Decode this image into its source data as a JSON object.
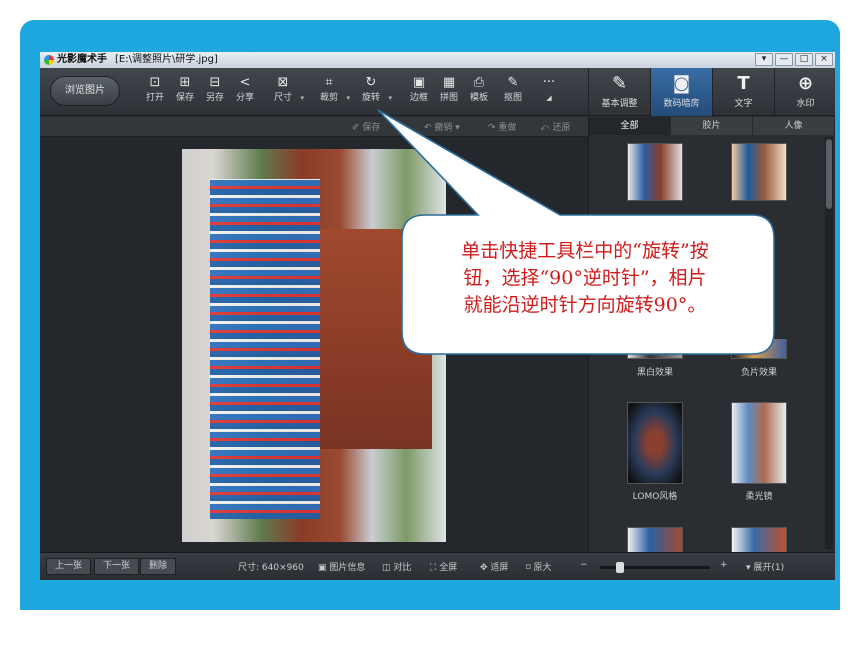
{
  "window": {
    "app_name": "光影魔术手",
    "file_path": "[E:\\调整照片\\研学.jpg]",
    "buttons": [
      "▾",
      "—",
      "□",
      "×"
    ]
  },
  "toolbar": {
    "browse_label": "浏览图片",
    "tools": [
      {
        "label": "打开",
        "icon": "open-icon",
        "glyph": "⊡"
      },
      {
        "label": "保存",
        "icon": "save-icon",
        "glyph": "⊞"
      },
      {
        "label": "另存",
        "icon": "save-as-icon",
        "glyph": "⊟"
      },
      {
        "label": "分享",
        "icon": "share-icon",
        "glyph": "<"
      },
      {
        "label": "尺寸",
        "icon": "resize-icon",
        "glyph": "⊠"
      },
      {
        "label": "裁剪",
        "icon": "crop-icon",
        "glyph": "⌗"
      },
      {
        "label": "旋转",
        "icon": "rotate-icon",
        "glyph": "↻"
      },
      {
        "label": "边框",
        "icon": "border-icon",
        "glyph": "▣"
      },
      {
        "label": "拼图",
        "icon": "collage-icon",
        "glyph": "▦"
      },
      {
        "label": "模板",
        "icon": "template-icon",
        "glyph": "⎙"
      },
      {
        "label": "抠图",
        "icon": "cutout-icon",
        "glyph": "✎"
      },
      {
        "label": "···",
        "icon": "more-icon",
        "glyph": "◢"
      }
    ],
    "modes": [
      {
        "label": "基本调整",
        "icon": "basic-adjust-icon",
        "glyph": "✎"
      },
      {
        "label": "数码暗房",
        "icon": "darkroom-icon",
        "glyph": "◙"
      },
      {
        "label": "文字",
        "icon": "text-icon",
        "glyph": "T"
      },
      {
        "label": "水印",
        "icon": "watermark-icon",
        "glyph": "⊕"
      }
    ]
  },
  "subbar": {
    "save_label": "保存",
    "undo_label": "撤销",
    "redo_label": "重做",
    "restore_label": "还原"
  },
  "side_panel": {
    "tabs": [
      "全部",
      "胶片",
      "人像"
    ],
    "effects": [
      "黑白效果",
      "负片效果",
      "LOMO风格",
      "柔光镜"
    ]
  },
  "status": {
    "prev": "上一张",
    "next": "下一张",
    "delete": "删除",
    "size": "尺寸: 640×960",
    "info": "图片信息",
    "compare": "对比",
    "fullscreen": "全屏",
    "fit": "适屏",
    "original": "原大",
    "zoom_minus": "−",
    "zoom_plus": "+",
    "expand": "▾ 展开(1)"
  },
  "callout": {
    "lines": [
      "单击快捷工具栏中的“旋转”按",
      "钮，选择“90°逆时针”，相片",
      "就能沿逆时针方向旋转90°。"
    ]
  }
}
